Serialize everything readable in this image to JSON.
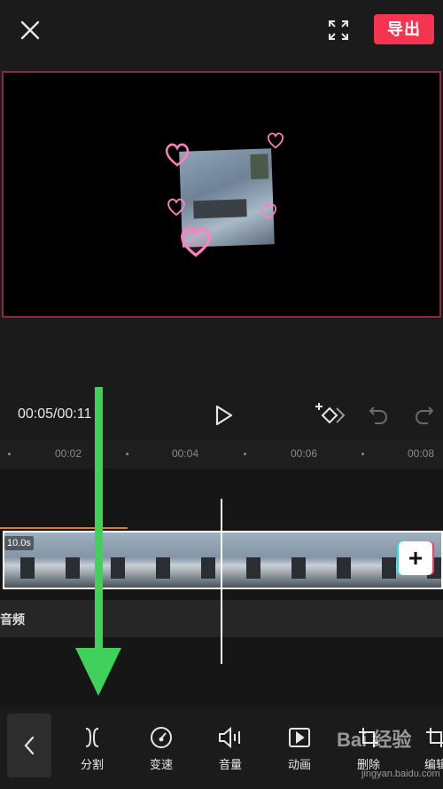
{
  "header": {
    "close_icon": "close-icon",
    "fullscreen_icon": "fullscreen-icon",
    "export_label": "导出"
  },
  "player": {
    "timecode": "00:05/00:11"
  },
  "timeline": {
    "ticks": [
      "00:02",
      "00:04",
      "00:06",
      "00:08"
    ],
    "clip_duration": "10.0s",
    "add_label": "+",
    "audio_label": "音频"
  },
  "toolbar": {
    "items": [
      {
        "label": "分割",
        "icon": "split-icon"
      },
      {
        "label": "变速",
        "icon": "speed-icon"
      },
      {
        "label": "音量",
        "icon": "volume-icon"
      },
      {
        "label": "动画",
        "icon": "animation-icon"
      },
      {
        "label": "删除",
        "icon": "delete-icon"
      },
      {
        "label": "编辑",
        "icon": "edit-icon"
      }
    ]
  },
  "watermark": {
    "text": "Bai 经验",
    "sub": "jingyan.baidu.com"
  },
  "colors": {
    "accent": "#f5344f",
    "arrow": "#3fd15a",
    "progress": "#e07a3a"
  }
}
